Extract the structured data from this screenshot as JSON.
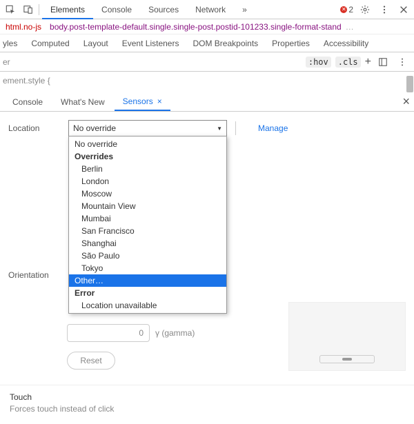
{
  "toolbar": {
    "tabs": [
      "Elements",
      "Console",
      "Sources",
      "Network"
    ],
    "active_tab": "Elements",
    "more_glyph": "»",
    "error_count": "2"
  },
  "breadcrumb": {
    "first": "html.no-js",
    "second": "body.post-template-default.single.single-post.postid-101233.single-format-stand",
    "ellipsis": "…"
  },
  "subtabs": {
    "cut": "yles",
    "items": [
      "Computed",
      "Layout",
      "Event Listeners",
      "DOM Breakpoints",
      "Properties",
      "Accessibility"
    ]
  },
  "filter": {
    "placeholder_cut": "er",
    "hov": ":hov",
    "cls": ".cls",
    "plus": "+"
  },
  "code": {
    "line": "ement.style {"
  },
  "drawer": {
    "tabs": [
      "Console",
      "What's New",
      "Sensors"
    ],
    "active": "Sensors",
    "close": "×"
  },
  "sensors": {
    "location_label": "Location",
    "selected": "No override",
    "manage": "Manage",
    "dropdown": {
      "no_override": "No override",
      "overrides_header": "Overrides",
      "cities": [
        "Berlin",
        "London",
        "Moscow",
        "Mountain View",
        "Mumbai",
        "San Francisco",
        "Shanghai",
        "São Paulo",
        "Tokyo"
      ],
      "other": "Other…",
      "error_header": "Error",
      "unavailable": "Location unavailable"
    },
    "orientation_label": "Orientation",
    "gamma_value": "0",
    "gamma_label": "γ (gamma)",
    "reset": "Reset"
  },
  "touch": {
    "title": "Touch",
    "subtitle": "Forces touch instead of click"
  }
}
